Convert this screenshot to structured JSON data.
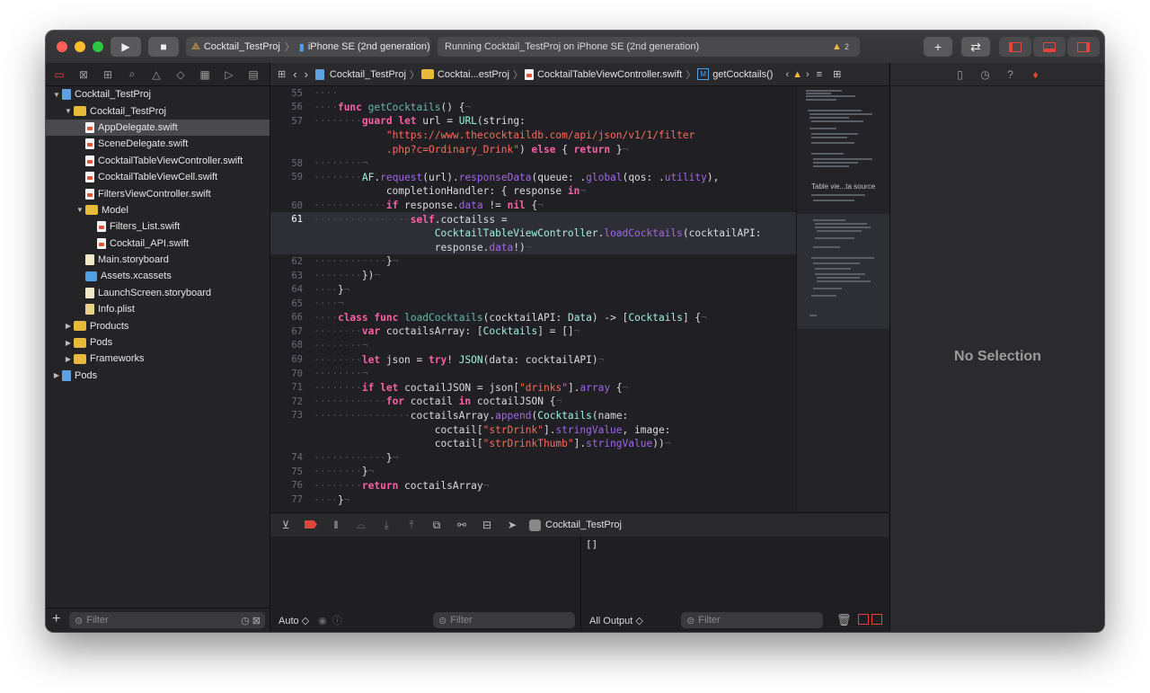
{
  "titlebar": {
    "scheme": "Cocktail_TestProj",
    "device": "iPhone SE (2nd generation)",
    "status": "Running Cocktail_TestProj on iPhone SE (2nd generation)",
    "warning_count": "2"
  },
  "navigator": {
    "items": [
      {
        "label": "Cocktail_TestProj",
        "type": "proj",
        "indent": 0,
        "disc": "▼"
      },
      {
        "label": "Cocktail_TestProj",
        "type": "folder",
        "indent": 1,
        "disc": "▼"
      },
      {
        "label": "AppDelegate.swift",
        "type": "swift",
        "indent": 2,
        "disc": "",
        "selected": true
      },
      {
        "label": "SceneDelegate.swift",
        "type": "swift",
        "indent": 2,
        "disc": ""
      },
      {
        "label": "CocktailTableViewController.swift",
        "type": "swift",
        "indent": 2,
        "disc": ""
      },
      {
        "label": "CocktailTableViewCell.swift",
        "type": "swift",
        "indent": 2,
        "disc": ""
      },
      {
        "label": "FiltersViewController.swift",
        "type": "swift",
        "indent": 2,
        "disc": ""
      },
      {
        "label": "Model",
        "type": "folder",
        "indent": 2,
        "disc": "▼"
      },
      {
        "label": "Filters_List.swift",
        "type": "swift",
        "indent": 3,
        "disc": ""
      },
      {
        "label": "Cocktail_API.swift",
        "type": "swift",
        "indent": 3,
        "disc": ""
      },
      {
        "label": "Main.storyboard",
        "type": "storyb",
        "indent": 2,
        "disc": ""
      },
      {
        "label": "Assets.xcassets",
        "type": "xc",
        "indent": 2,
        "disc": ""
      },
      {
        "label": "LaunchScreen.storyboard",
        "type": "storyb",
        "indent": 2,
        "disc": ""
      },
      {
        "label": "Info.plist",
        "type": "plist",
        "indent": 2,
        "disc": ""
      },
      {
        "label": "Products",
        "type": "folder",
        "indent": 1,
        "disc": "▶"
      },
      {
        "label": "Pods",
        "type": "folder",
        "indent": 1,
        "disc": "▶"
      },
      {
        "label": "Frameworks",
        "type": "folder",
        "indent": 1,
        "disc": "▶"
      },
      {
        "label": "Pods",
        "type": "proj",
        "indent": 0,
        "disc": "▶"
      }
    ],
    "filter_placeholder": "Filter"
  },
  "jumpbar": {
    "crumbs": [
      "Cocktail_TestProj",
      "Cocktai...estProj",
      "CocktailTableViewController.swift",
      "getCocktails()"
    ]
  },
  "editor": {
    "current_line": "61",
    "lines": [
      {
        "n": "55",
        "html": "<span class='ws'>····</span>"
      },
      {
        "n": "56",
        "html": "<span class='ws'>····</span><span class='kw'>func</span> <span class='fn'>getCocktails</span>() {<span class='ws'>¬</span>"
      },
      {
        "n": "57",
        "html": "<span class='ws'>········</span><span class='kw'>guard</span> <span class='kw'>let</span> url = <span class='ty'>URL</span>(string:"
      },
      {
        "n": "",
        "html": "            <span class='str'>\"https://www.thecocktaildb.com/api/json/v1/1/filter</span>"
      },
      {
        "n": "",
        "html": "            <span class='str'>.php?c=Ordinary_Drink\"</span>) <span class='kw'>else</span> { <span class='kw'>return</span> }<span class='ws'>¬</span>"
      },
      {
        "n": "58",
        "html": "<span class='ws'>········¬</span>"
      },
      {
        "n": "59",
        "html": "<span class='ws'>········</span><span class='ty'>AF</span>.<span class='mem'>request</span>(url).<span class='mem'>responseData</span>(queue: .<span class='mem'>global</span>(qos: .<span class='mem'>utility</span>),"
      },
      {
        "n": "",
        "html": "            completionHandler: { response <span class='kw'>in</span><span class='ws'>¬</span>"
      },
      {
        "n": "60",
        "html": "<span class='ws'>············</span><span class='kw'>if</span> response.<span class='mem'>data</span> != <span class='kw'>nil</span> {<span class='ws'>¬</span>"
      },
      {
        "n": "61",
        "html": "<span class='ws'>················</span><span class='kw'>self</span>.coctailss =",
        "cur": true
      },
      {
        "n": "",
        "html": "                    <span class='ty'>CocktailTableViewController</span>.<span class='mem'>loadCocktails</span>(cocktailAPI:",
        "cur": true
      },
      {
        "n": "",
        "html": "                    response.<span class='mem'>data</span>!)<span class='ws'>¬</span>",
        "cur": true
      },
      {
        "n": "62",
        "html": "<span class='ws'>············</span>}<span class='ws'>¬</span>"
      },
      {
        "n": "63",
        "html": "<span class='ws'>········</span>})<span class='ws'>¬</span>"
      },
      {
        "n": "64",
        "html": "<span class='ws'>····</span>}<span class='ws'>¬</span>"
      },
      {
        "n": "65",
        "html": "<span class='ws'>····¬</span>"
      },
      {
        "n": "66",
        "html": "<span class='ws'>····</span><span class='kw'>class</span> <span class='kw'>func</span> <span class='fn'>loadCocktails</span>(cocktailAPI: <span class='ty'>Data</span>) -> [<span class='ty'>Cocktails</span>] {<span class='ws'>¬</span>"
      },
      {
        "n": "67",
        "html": "<span class='ws'>········</span><span class='kw'>var</span> coctailsArray: [<span class='ty'>Cocktails</span>] = []<span class='ws'>¬</span>"
      },
      {
        "n": "68",
        "html": "<span class='ws'>········¬</span>"
      },
      {
        "n": "69",
        "html": "<span class='ws'>········</span><span class='kw'>let</span> json = <span class='kw'>try</span>! <span class='ty'>JSON</span>(data: cocktailAPI)<span class='ws'>¬</span>"
      },
      {
        "n": "70",
        "html": "<span class='ws'>········¬</span>"
      },
      {
        "n": "71",
        "html": "<span class='ws'>········</span><span class='kw'>if</span> <span class='kw'>let</span> coctailJSON = json[<span class='str'>\"drinks\"</span>].<span class='mem'>array</span> {<span class='ws'>¬</span>"
      },
      {
        "n": "72",
        "html": "<span class='ws'>············</span><span class='kw'>for</span> coctail <span class='kw'>in</span> coctailJSON {<span class='ws'>¬</span>"
      },
      {
        "n": "73",
        "html": "<span class='ws'>················</span>coctailsArray.<span class='mem'>append</span>(<span class='ty'>Cocktails</span>(name:"
      },
      {
        "n": "",
        "html": "                    coctail[<span class='str'>\"strDrink\"</span>].<span class='mem'>stringValue</span>, image:"
      },
      {
        "n": "",
        "html": "                    coctail[<span class='str'>\"strDrinkThumb\"</span>].<span class='mem'>stringValue</span>))<span class='ws'>¬</span>"
      },
      {
        "n": "74",
        "html": "<span class='ws'>············</span>}<span class='ws'>¬</span>"
      },
      {
        "n": "75",
        "html": "<span class='ws'>········</span>}<span class='ws'>¬</span>"
      },
      {
        "n": "76",
        "html": "<span class='ws'>········</span><span class='kw'>return</span> coctailsArray<span class='ws'>¬</span>"
      },
      {
        "n": "77",
        "html": "<span class='ws'>····</span>}<span class='ws'>¬</span>"
      }
    ]
  },
  "minimap": {
    "section_label": "Table vie...ta source"
  },
  "inspector": {
    "empty_label": "No Selection"
  },
  "debug": {
    "target": "Cocktail_TestProj",
    "console_output": "[]",
    "vars_scope": "Auto ◇",
    "output_scope": "All Output ◇",
    "filter_placeholder": "Filter"
  },
  "colors": {
    "accent_red": "#e0453b",
    "keyword": "#fc5fa3",
    "string": "#fc6a5d",
    "type": "#9ef1dd",
    "member": "#a167e6"
  }
}
